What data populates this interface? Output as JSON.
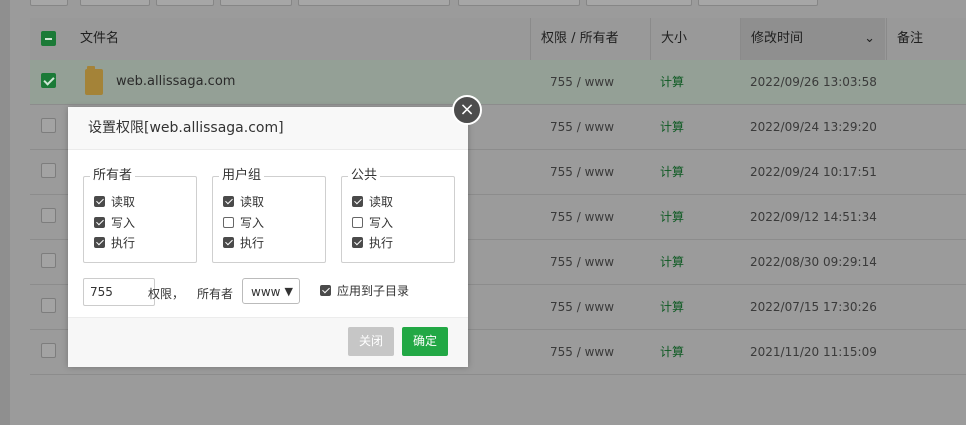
{
  "table": {
    "columns": {
      "filename": "文件名",
      "permission": "权限 / 所有者",
      "size": "大小",
      "modified": "修改时间",
      "note": "备注"
    },
    "rows": [
      {
        "name": "web.allissaga.com",
        "perm": "755 / www",
        "size": "计算",
        "mtime": "2022/09/26 13:03:58",
        "checked": true
      },
      {
        "name": "",
        "perm": "755 / www",
        "size": "计算",
        "mtime": "2022/09/24 13:29:20",
        "checked": false
      },
      {
        "name": "",
        "perm": "755 / www",
        "size": "计算",
        "mtime": "2022/09/24 10:17:51",
        "checked": false
      },
      {
        "name": "",
        "perm": "755 / www",
        "size": "计算",
        "mtime": "2022/09/12 14:51:34",
        "checked": false
      },
      {
        "name": "",
        "perm": "755 / www",
        "size": "计算",
        "mtime": "2022/08/30 09:29:14",
        "checked": false
      },
      {
        "name": "",
        "perm": "755 / www",
        "size": "计算",
        "mtime": "2022/07/15 17:30:26",
        "checked": false
      },
      {
        "name": "",
        "perm": "755 / www",
        "size": "计算",
        "mtime": "2021/11/20 11:15:09",
        "checked": false
      }
    ]
  },
  "dialog": {
    "title": "设置权限[web.allissaga.com]",
    "groups": [
      {
        "label": "所有者",
        "read": "读取",
        "write": "写入",
        "exec": "执行",
        "read_checked": true,
        "write_checked": true,
        "exec_checked": true
      },
      {
        "label": "用户组",
        "read": "读取",
        "write": "写入",
        "exec": "执行",
        "read_checked": true,
        "write_checked": false,
        "exec_checked": true
      },
      {
        "label": "公共",
        "read": "读取",
        "write": "写入",
        "exec": "执行",
        "read_checked": true,
        "write_checked": false,
        "exec_checked": true
      }
    ],
    "permission_value": "755",
    "permission_label": "权限，",
    "owner_label": "所有者",
    "owner_value": "www",
    "apply_subdirs_label": "应用到子目录",
    "apply_subdirs_checked": true,
    "close_button": "关闭",
    "ok_button": "确定",
    "close_icon": "close-icon"
  },
  "colors": {
    "ok_green": "#22a845",
    "accent_green": "#1b7a37"
  }
}
